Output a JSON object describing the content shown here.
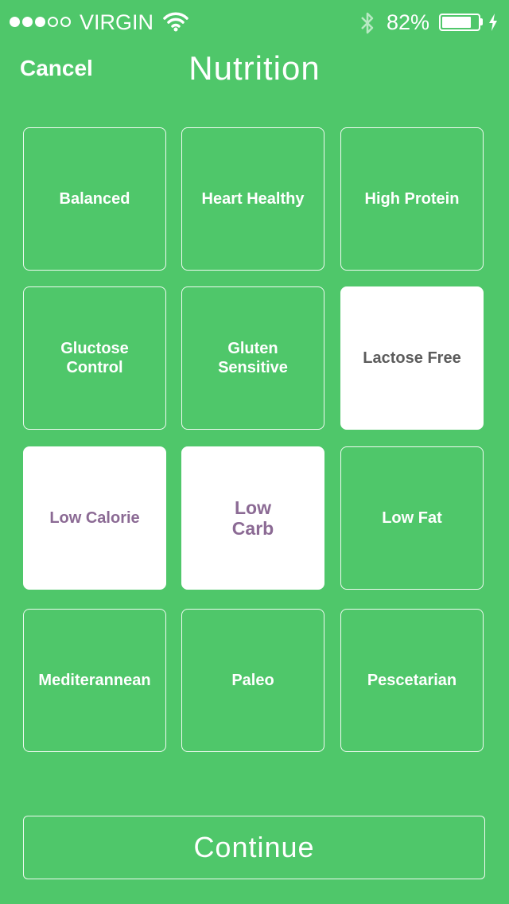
{
  "status_bar": {
    "carrier": "VIRGIN",
    "signal_filled": 3,
    "signal_total": 5,
    "battery_percent": "82%"
  },
  "nav": {
    "cancel_label": "Cancel",
    "title": "Nutrition"
  },
  "options": [
    {
      "label": "Balanced",
      "selected": false
    },
    {
      "label": "Heart Healthy",
      "selected": false
    },
    {
      "label": "High Protein",
      "selected": false
    },
    {
      "label": "Gluctose\nControl",
      "selected": false
    },
    {
      "label": "Gluten\nSensitive",
      "selected": false
    },
    {
      "label": "Lactose Free",
      "selected": true
    },
    {
      "label": "Low Calorie",
      "selected": true
    },
    {
      "label": "Low\nCarb",
      "selected": true
    },
    {
      "label": "Low Fat",
      "selected": false
    },
    {
      "label": "Mediterannean",
      "selected": false
    },
    {
      "label": "Paleo",
      "selected": false
    },
    {
      "label": "Pescetarian",
      "selected": false
    }
  ],
  "continue_label": "Continue",
  "colors": {
    "background": "#4fc76a",
    "selected_tile": "#ffffff",
    "selected_text_gray": "#5c5c5c",
    "selected_text_purple": "#8b6a94"
  }
}
